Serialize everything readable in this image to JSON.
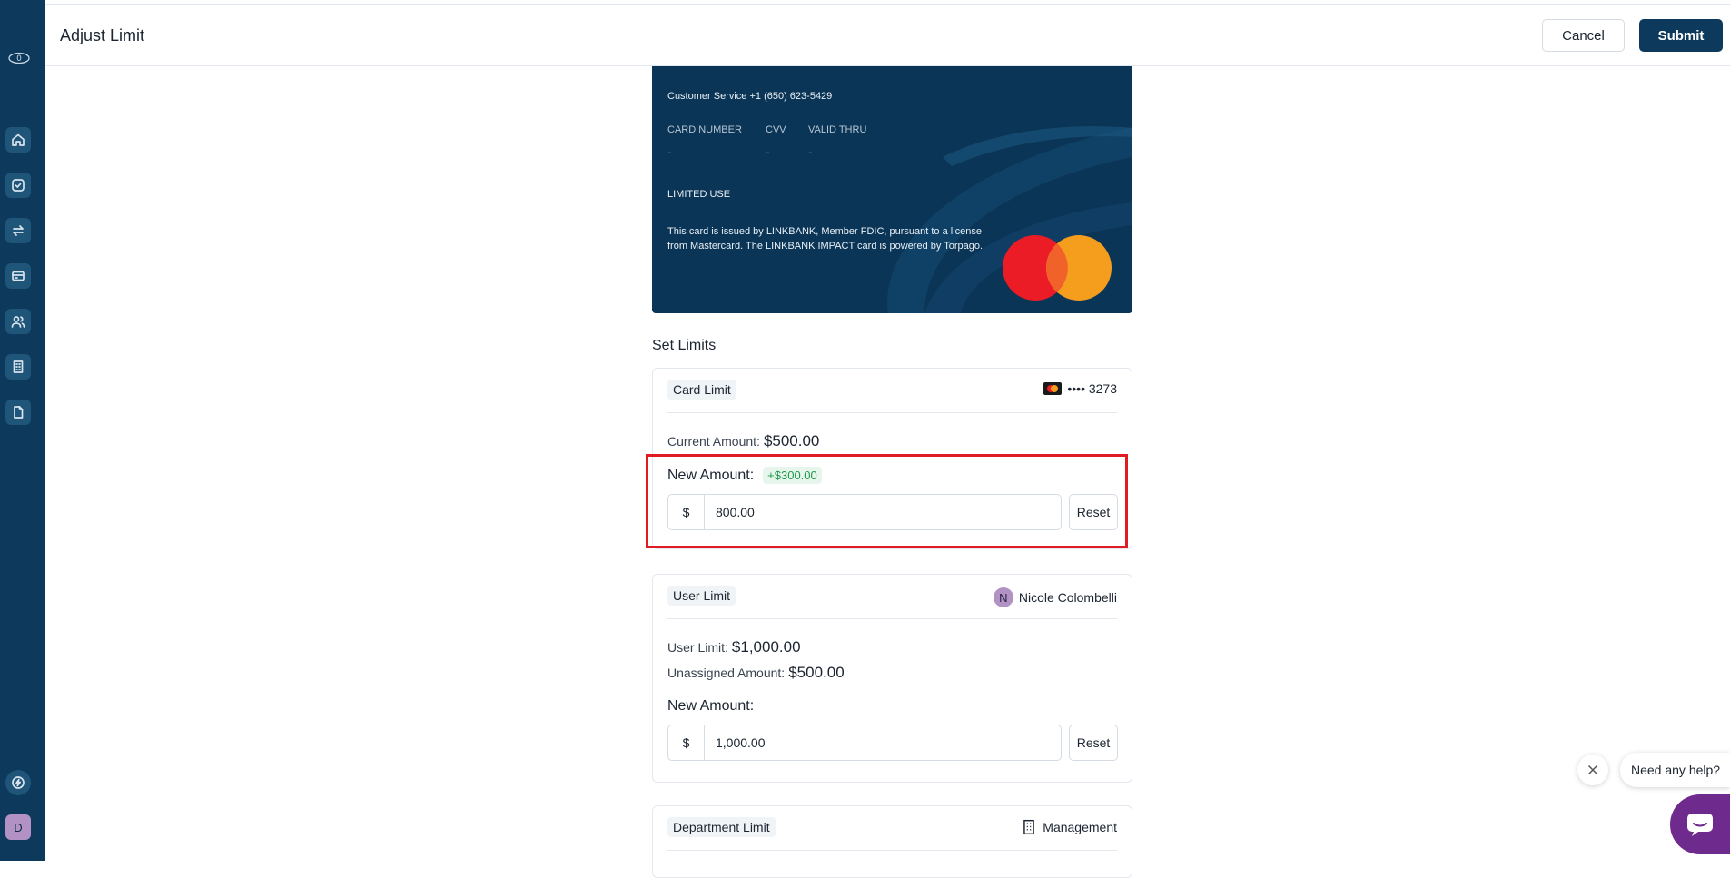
{
  "header": {
    "title": "Adjust Limit",
    "cancel_label": "Cancel",
    "submit_label": "Submit"
  },
  "sidebar": {
    "logo_icon": "eye-logo-icon",
    "items": [
      {
        "icon": "home-icon"
      },
      {
        "icon": "check-circle-icon"
      },
      {
        "icon": "transfer-icon"
      },
      {
        "icon": "card-icon"
      },
      {
        "icon": "users-icon"
      },
      {
        "icon": "building-icon"
      },
      {
        "icon": "document-icon"
      }
    ],
    "bottom": {
      "icon": "lightning-icon",
      "avatar_initial": "D"
    }
  },
  "card": {
    "customer_service": "Customer Service +1 (650) 623-5429",
    "card_number_label": "CARD NUMBER",
    "card_number_value": "-",
    "cvv_label": "CVV",
    "cvv_value": "-",
    "valid_thru_label": "VALID THRU",
    "valid_thru_value": "-",
    "use_type": "LIMITED USE",
    "disclaimer_line1": "This card is issued by LINKBANK, Member FDIC, pursuant to a license",
    "disclaimer_line2": "from Mastercard. The LINKBANK IMPACT card is powered by Torpago."
  },
  "set_limits": {
    "title": "Set Limits",
    "card_limit": {
      "label": "Card Limit",
      "card_masked": "•••• 3273",
      "current_amount_label": "Current Amount:",
      "current_amount": "$500.00",
      "new_amount_label": "New Amount:",
      "delta": "+$300.00",
      "currency": "$",
      "input_value": "800.00",
      "reset_label": "Reset"
    },
    "user_limit": {
      "label": "User Limit",
      "user_initial": "N",
      "user_name": "Nicole Colombelli",
      "user_limit_label": "User Limit:",
      "user_limit_value": "$1,000.00",
      "unassigned_label": "Unassigned Amount:",
      "unassigned_value": "$500.00",
      "new_amount_label": "New Amount:",
      "currency": "$",
      "input_value": "1,000.00",
      "reset_label": "Reset"
    },
    "department_limit": {
      "label": "Department Limit",
      "department_name": "Management"
    }
  },
  "help": {
    "prompt": "Need any help?"
  },
  "colors": {
    "sidebar": "#0d3a5c",
    "accent": "#0d3a5c",
    "highlight": "#e01b24",
    "delta_green": "#1f9a4a",
    "chat": "#6e2a8c"
  }
}
